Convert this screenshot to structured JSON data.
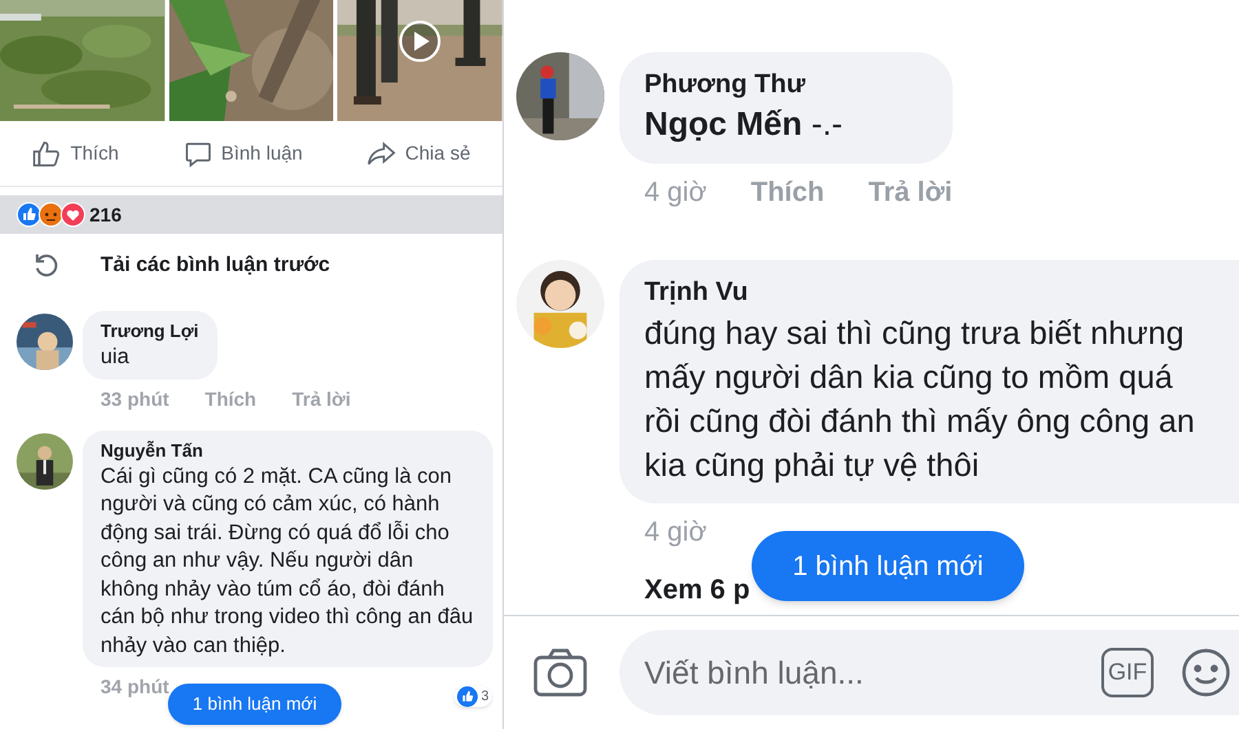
{
  "left_screen": {
    "post_media": [
      {
        "kind": "picture"
      },
      {
        "kind": "picture"
      },
      {
        "kind": "video"
      }
    ],
    "post_actions": [
      {
        "kind": "like",
        "label": "Thích"
      },
      {
        "kind": "comment",
        "label": "Bình luận"
      },
      {
        "kind": "share",
        "label": "Chia sẻ"
      }
    ],
    "reactions": {
      "count": "216"
    },
    "load_previous": "Tải các bình luận trước",
    "comments": [
      {
        "author": "Trương Lợi",
        "text": "uia",
        "time": "33 phút",
        "actions": [
          "Thích",
          "Trả lời"
        ]
      },
      {
        "author": "Nguyễn Tấn",
        "text": "Cái gì cũng có 2 mặt. CA cũng là con người và cũng có cảm xúc, có hành động sai trái. Đừng có quá đổ lỗi cho công an như vậy. Nếu người dân không nhảy vào túm cổ áo, đòi đánh cán bộ như trong video thì công an đâu nhảy vào can thiệp.",
        "time": "34 phút",
        "like_count": "3"
      }
    ],
    "new_comments_button": "1 bình luận mới"
  },
  "right_screen": {
    "comments": [
      {
        "author": "Phương Thư",
        "text": "**Ngọc Mến** -.-",
        "time": "4 giờ",
        "actions": [
          "Thích",
          "Trả lời"
        ]
      },
      {
        "author": "Trịnh Vu",
        "text": "đúng hay sai thì cũng trưa biết nhưng mấy người dân kia cũng to mồm quá rồi cũng đòi đánh thì mấy ông công an kia cũng phải tự vệ thôi",
        "time": "4 giờ"
      }
    ],
    "more_replies": "Xem 6 p",
    "new_comments_button": "1 bình luận mới",
    "composer": {
      "placeholder": "Viết bình luận...",
      "gif_label": "GIF"
    }
  }
}
